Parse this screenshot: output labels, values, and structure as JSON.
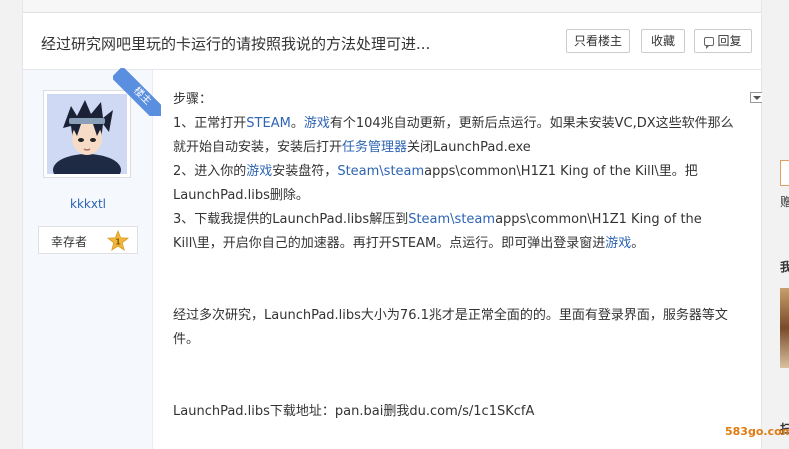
{
  "thread": {
    "title": "经过研究网吧里玩的卡运行的请按照我说的方法处理可进...",
    "buttons": {
      "only_op": "只看楼主",
      "favorite": "收藏",
      "reply": "回复"
    }
  },
  "post": {
    "op_badge": "楼主",
    "author": {
      "name": "kkkxtl",
      "level_title": "幸存者",
      "level_number": "1"
    },
    "lines": [
      [
        {
          "t": "步骤："
        }
      ],
      [
        {
          "t": "1、正常打开"
        },
        {
          "t": "STEAM",
          "link": true
        },
        {
          "t": "。"
        },
        {
          "t": "游戏",
          "link": true
        },
        {
          "t": "有个104兆自动更新，更新后点运行。如果未安装VC,DX这些软件那么就开始自动安装，安装后打开"
        },
        {
          "t": "任务管理器",
          "link": true
        },
        {
          "t": "关闭LaunchPad.exe"
        }
      ],
      [
        {
          "t": "2、进入你的"
        },
        {
          "t": "游戏",
          "link": true
        },
        {
          "t": "安装盘符，"
        },
        {
          "t": "Steam\\steam",
          "link": true
        },
        {
          "t": "apps\\common\\H1Z1 King of the Kill\\里。把LaunchPad.libs删除。"
        }
      ],
      [
        {
          "t": "3、下载我提供的LaunchPad.libs解压到"
        },
        {
          "t": "Steam\\steam",
          "link": true
        },
        {
          "t": "apps\\common\\H1Z1 King of the Kill\\里，开启你自己的加速器。再打开STEAM。点运行。即可弹出登录窗进"
        },
        {
          "t": "游戏",
          "link": true
        },
        {
          "t": "。"
        }
      ],
      [],
      [
        {
          "t": "经过多次研究，LaunchPad.libs大小为76.1兆才是正常全面的的。里面有登录界面，服务器等文件。"
        }
      ],
      [],
      [
        {
          "t": "LaunchPad.libs下载地址：pan.bai删我du.com/s/1c1SKcfA"
        }
      ]
    ]
  },
  "right_rail": {
    "glyph_1": "赠",
    "glyph_2": "我",
    "glyph_3": "扫"
  },
  "watermark": "583go.com",
  "colors": {
    "link": "#2d64b3",
    "op_badge": "#5a8fe0",
    "level_badge": "#f0b73a",
    "watermark": "#e07a10"
  }
}
